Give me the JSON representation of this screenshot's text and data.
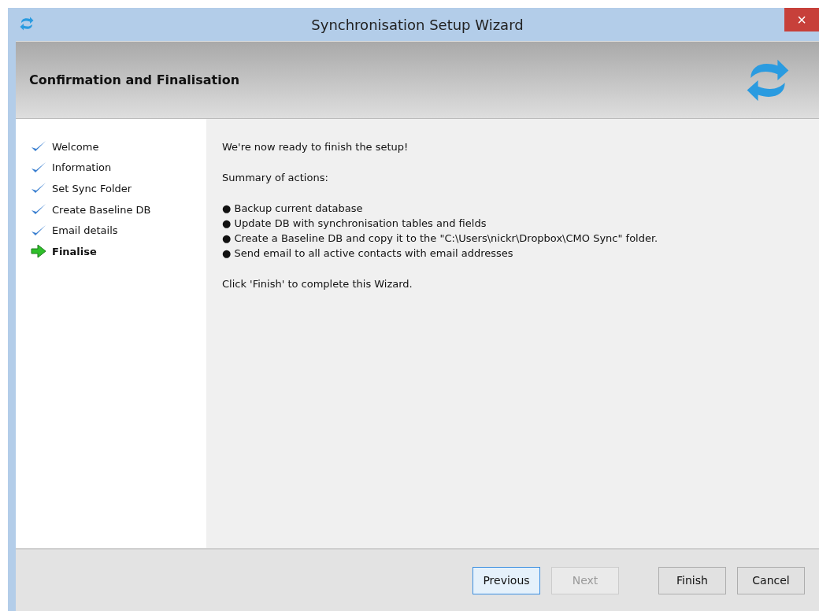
{
  "window": {
    "title": "Synchronisation Setup Wizard",
    "close": "×"
  },
  "header": {
    "title": "Confirmation and Finalisation"
  },
  "steps": [
    {
      "label": "Welcome",
      "kind": "done"
    },
    {
      "label": "Information",
      "kind": "done"
    },
    {
      "label": "Set Sync Folder",
      "kind": "done"
    },
    {
      "label": "Create Baseline DB",
      "kind": "done"
    },
    {
      "label": "Email details",
      "kind": "done"
    },
    {
      "label": "Finalise",
      "kind": "current"
    }
  ],
  "content": {
    "intro": "We're now ready to finish the setup!",
    "summary_heading": "Summary of actions:",
    "actions": [
      "● Backup current database",
      "● Update DB with synchronisation tables and fields",
      "● Create a Baseline DB and copy it to the \"C:\\Users\\nickr\\Dropbox\\CMO Sync\" folder.",
      "● Send email to all active contacts with email addresses"
    ],
    "closing": "Click 'Finish' to complete this Wizard."
  },
  "buttons": [
    {
      "label": "Previous",
      "focused": true,
      "disabled": false
    },
    {
      "label": "Next",
      "focused": false,
      "disabled": true
    },
    {
      "label": "Finish",
      "focused": false,
      "disabled": false
    },
    {
      "label": "Cancel",
      "focused": false,
      "disabled": false
    }
  ]
}
